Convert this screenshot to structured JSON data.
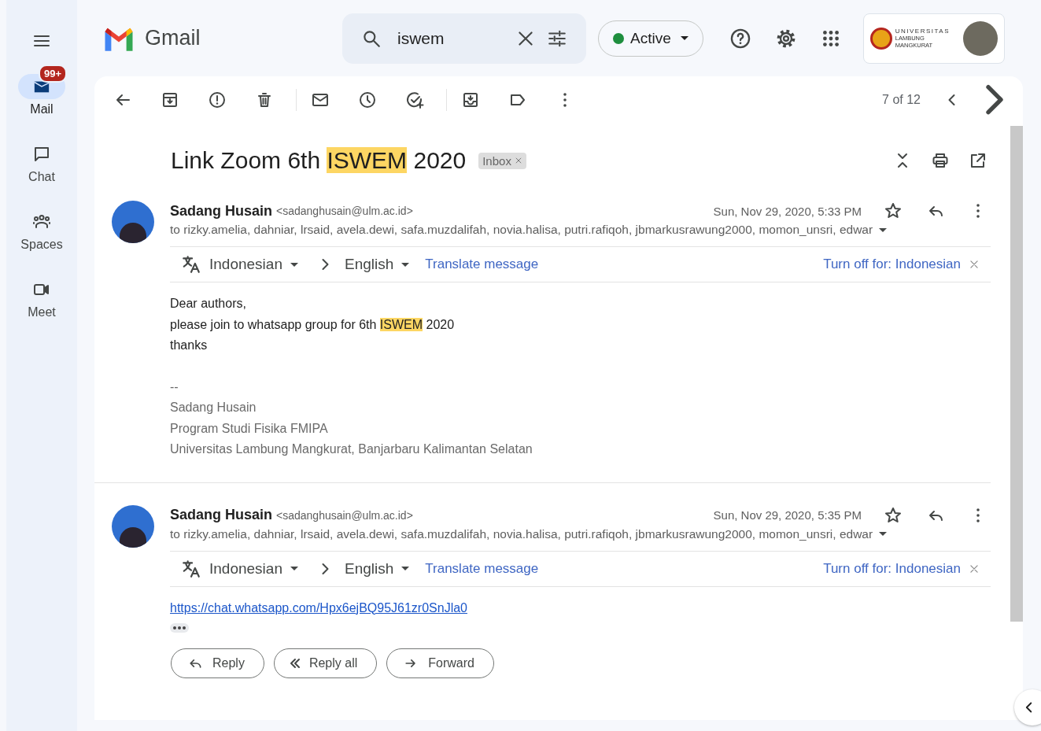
{
  "app": {
    "name": "Gmail"
  },
  "search": {
    "value": "iswem"
  },
  "status": {
    "label": "Active"
  },
  "account": {
    "org_name": "UNIVERSITAS",
    "org_subname": "LAMBUNG MANGKURAT"
  },
  "rail": [
    {
      "kind": "mail",
      "label": "Mail",
      "selected": true,
      "badge": "99+"
    },
    {
      "kind": "chat",
      "label": "Chat",
      "selected": false
    },
    {
      "kind": "spaces",
      "label": "Spaces",
      "selected": false
    },
    {
      "kind": "meet",
      "label": "Meet",
      "selected": false
    }
  ],
  "toolbar": {
    "position": "7 of 12"
  },
  "subject": {
    "parts": [
      {
        "text": "Link Zoom 6th ",
        "highlighted": false
      },
      {
        "text": "ISWEM",
        "highlighted": true
      },
      {
        "text": " 2020",
        "highlighted": false
      }
    ],
    "label": "Inbox"
  },
  "messages": [
    {
      "sender": "Sadang Husain",
      "email": "<sadanghusain@ulm.ac.id>",
      "date": "Sun, Nov 29, 2020, 5:33 PM",
      "recipients": "to rizky.amelia, dahniar, lrsaid, avela.dewi, safa.muzdalifah, novia.halisa, putri.rafiqoh, jbmarkusrawung2000, momon_unsri, edwar",
      "translate": {
        "from": "Indonesian",
        "to": "English",
        "action": "Translate message",
        "turn_off": "Turn off for: Indonesian"
      },
      "body": [
        {
          "kind": "text",
          "parts": [
            {
              "text": "Dear authors,",
              "highlighted": false
            }
          ]
        },
        {
          "kind": "text",
          "parts": [
            {
              "text": "please join to whatsapp group for 6th ",
              "highlighted": false
            },
            {
              "text": "ISWEM",
              "highlighted": true
            },
            {
              "text": " 2020",
              "highlighted": false
            }
          ]
        },
        {
          "kind": "text",
          "parts": [
            {
              "text": "thanks",
              "highlighted": false
            }
          ]
        },
        {
          "kind": "signature",
          "text": "--"
        },
        {
          "kind": "signature",
          "text": "Sadang Husain"
        },
        {
          "kind": "signature",
          "text": "Program Studi Fisika FMIPA"
        },
        {
          "kind": "signature",
          "text": "Universitas Lambung Mangkurat, Banjarbaru Kalimantan Selatan"
        }
      ]
    },
    {
      "sender": "Sadang Husain",
      "email": "<sadanghusain@ulm.ac.id>",
      "date": "Sun, Nov 29, 2020, 5:35 PM",
      "recipients": "to rizky.amelia, dahniar, lrsaid, avela.dewi, safa.muzdalifah, novia.halisa, putri.rafiqoh, jbmarkusrawung2000, momon_unsri, edwar",
      "translate": {
        "from": "Indonesian",
        "to": "English",
        "action": "Translate message",
        "turn_off": "Turn off for: Indonesian"
      },
      "body": [
        {
          "kind": "link",
          "text": "https://chat.whatsapp.com/Hpx6ejBQ95J61zr0SnJla0"
        },
        {
          "kind": "trimmed"
        }
      ]
    }
  ],
  "actions": [
    {
      "kind": "reply",
      "label": "Reply"
    },
    {
      "kind": "reply_all",
      "label": "Reply all"
    },
    {
      "kind": "forward",
      "label": "Forward"
    }
  ]
}
